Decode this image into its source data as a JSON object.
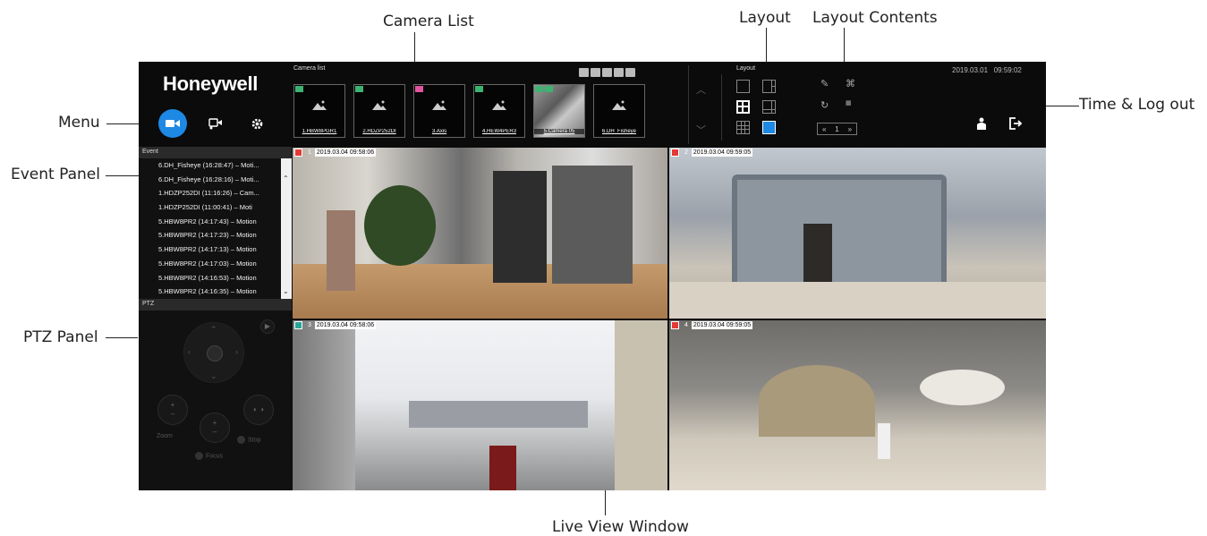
{
  "callouts": {
    "camera_list": "Camera List",
    "layout": "Layout",
    "layout_contents": "Layout Contents",
    "menu": "Menu",
    "time_logout": "Time & Log out",
    "event_panel": "Event Panel",
    "ptz_panel": "PTZ Panel",
    "live_view": "Live View Window"
  },
  "app": {
    "logo": "Honeywell",
    "menu": {
      "items": [
        {
          "icon": "video-camera-icon",
          "active": true
        },
        {
          "icon": "camera-settings-icon",
          "active": false
        },
        {
          "icon": "gear-icon",
          "active": false
        }
      ]
    },
    "camera_list": {
      "label": "Camera list",
      "toolbar_icons": [
        "minus-icon",
        "back-icon",
        "eye-icon",
        "record-icon",
        "download-icon"
      ],
      "cameras": [
        {
          "name": "1.HBW8PGR1",
          "tag": "green",
          "photo": false
        },
        {
          "name": "2.HDZP252DI",
          "tag": "green",
          "photo": false
        },
        {
          "name": "3.Axis",
          "tag": "pink",
          "photo": false
        },
        {
          "name": "4.HEW4PER3",
          "tag": "green",
          "photo": false
        },
        {
          "name": "5.Camera 05",
          "tag": "green",
          "photo": true
        },
        {
          "name": "6.DH_Fisheye",
          "tag": "none",
          "photo": false
        }
      ]
    },
    "layout": {
      "label": "Layout",
      "page": "1"
    },
    "datetime": {
      "date": "2019.03.01",
      "time": "09:59:02"
    },
    "event_panel": {
      "title": "Event",
      "events": [
        "6.DH_Fisheye (16:28:47) – Moti...",
        "6.DH_Fisheye (16:28:16) – Moti...",
        "1.HDZP252DI (11:16:26) – Cam...",
        "1.HDZP252DI (11:00:41) – Moti",
        "5.HBW8PR2 (14:17:43) – Motion",
        "5.HBW8PR2 (14:17:23) – Motion",
        "5.HBW8PR2 (14:17:13) – Motion",
        "5.HBW8PR2 (14:17:03) – Motion",
        "5.HBW8PR2 (14:16:53) – Motion",
        "5.HBW8PR2 (14:16:35) – Motion"
      ]
    },
    "ptz_panel": {
      "title": "PTZ",
      "zoom_label": "Zoom",
      "stop_label": "Stop",
      "focus_label": "Focus"
    },
    "tiles": [
      {
        "num": "1",
        "timestamp": "2019.03.04 09:58:06",
        "id_color": "red"
      },
      {
        "num": "2",
        "timestamp": "2019.03.04 09:59:05",
        "id_color": "red"
      },
      {
        "num": "3",
        "timestamp": "2019.03.04 09:58:06",
        "id_color": "green"
      },
      {
        "num": "4",
        "timestamp": "2019.03.04 09:59:05",
        "id_color": "red"
      }
    ]
  }
}
